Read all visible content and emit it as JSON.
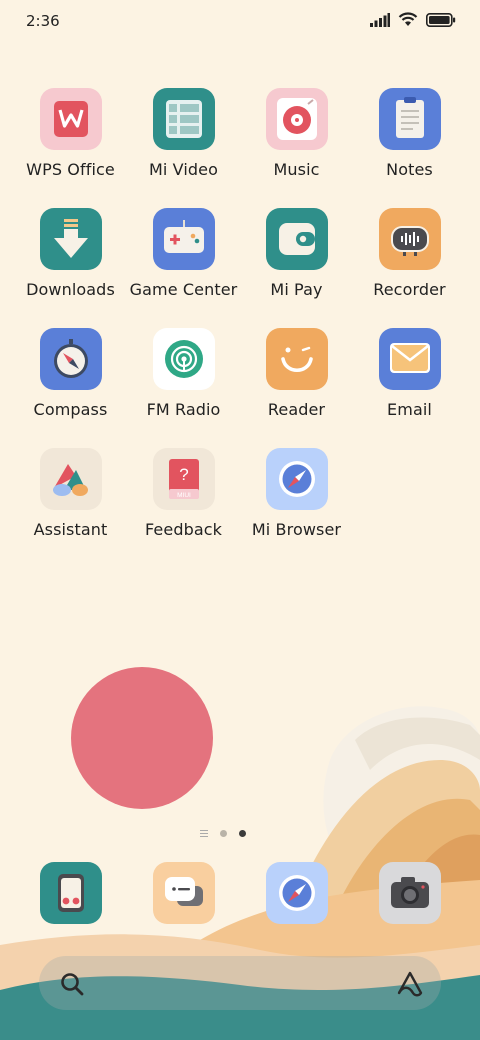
{
  "status_bar": {
    "time": "2:36"
  },
  "apps": [
    {
      "label": "WPS Office",
      "icon": "wps-office-icon"
    },
    {
      "label": "Mi Video",
      "icon": "mi-video-icon"
    },
    {
      "label": "Music",
      "icon": "music-icon"
    },
    {
      "label": "Notes",
      "icon": "notes-icon"
    },
    {
      "label": "Downloads",
      "icon": "downloads-icon"
    },
    {
      "label": "Game Center",
      "icon": "game-center-icon"
    },
    {
      "label": "Mi Pay",
      "icon": "mi-pay-icon"
    },
    {
      "label": "Recorder",
      "icon": "recorder-icon"
    },
    {
      "label": "Compass",
      "icon": "compass-icon"
    },
    {
      "label": "FM Radio",
      "icon": "fm-radio-icon"
    },
    {
      "label": "Reader",
      "icon": "reader-icon"
    },
    {
      "label": "Email",
      "icon": "email-icon"
    },
    {
      "label": "Assistant",
      "icon": "assistant-icon"
    },
    {
      "label": "Feedback",
      "icon": "feedback-icon"
    },
    {
      "label": "Mi Browser",
      "icon": "mi-browser-icon"
    }
  ],
  "feedback_badge": "MIUI",
  "pager": {
    "pages": 2,
    "active": 2
  },
  "dock": [
    {
      "icon": "tools-icon"
    },
    {
      "icon": "messaging-icon"
    },
    {
      "icon": "browser-icon"
    },
    {
      "icon": "camera-icon"
    }
  ],
  "colors": {
    "background": "#fcf3e3",
    "sun": "#e4737e",
    "teal": "#2f8f8a",
    "blue": "#5a7fd8",
    "orange": "#f0a95f",
    "pink": "#f6c9cf",
    "cream": "#f1e7d8"
  }
}
